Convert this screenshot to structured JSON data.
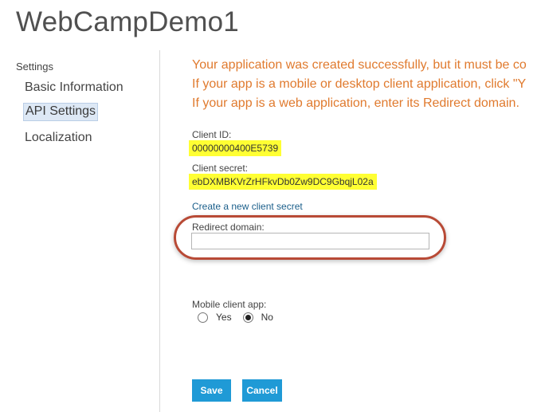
{
  "app": {
    "title": "WebCampDemo1"
  },
  "sidebar": {
    "heading": "Settings",
    "items": [
      {
        "label": "Basic Information",
        "active": false
      },
      {
        "label": "API Settings",
        "active": true
      },
      {
        "label": "Localization",
        "active": false
      }
    ]
  },
  "notice": {
    "lines": [
      "Your application was created successfully, but it must be co",
      "If your app is a mobile or desktop client application, click \"Y",
      "If your app is a web application, enter its Redirect domain."
    ],
    "color": "#e07a2e"
  },
  "client_id": {
    "label": "Client ID:",
    "value": "00000000400E5739"
  },
  "client_secret": {
    "label": "Client secret:",
    "value": "ebDXMBKVrZrHFkvDb0Zw9DC9GbqjL02a"
  },
  "create_secret_link": "Create a new client secret",
  "redirect_domain": {
    "label": "Redirect domain:",
    "value": "",
    "placeholder": ""
  },
  "mobile_client_app": {
    "label": "Mobile client app:",
    "options": [
      {
        "label": "Yes",
        "selected": false
      },
      {
        "label": "No",
        "selected": true
      }
    ]
  },
  "buttons": {
    "save": "Save",
    "cancel": "Cancel"
  },
  "colors": {
    "accent": "#1f9ad6",
    "highlight": "#ffff33",
    "annotation": "#b84a36",
    "link": "#1a5e8a"
  }
}
